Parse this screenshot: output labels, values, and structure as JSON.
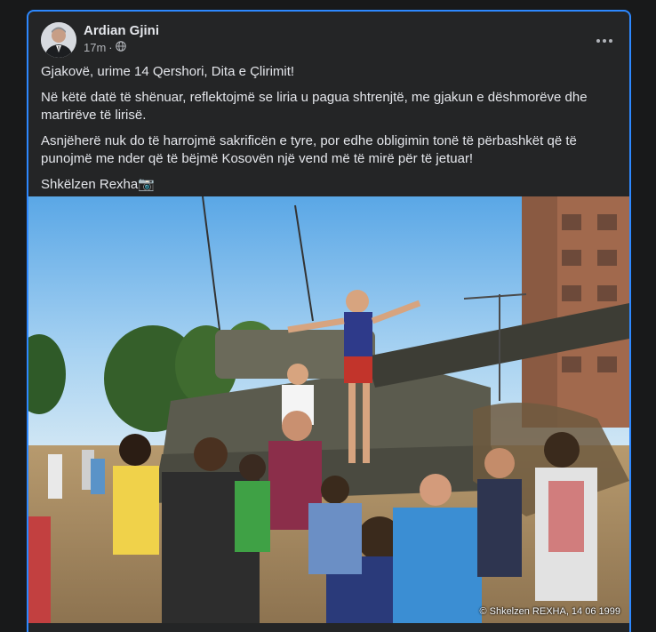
{
  "post": {
    "author_name": "Ardian Gjini",
    "timestamp": "17m",
    "separator": "·",
    "privacy_icon": "globe-icon",
    "more_icon": "more-horizontal-icon",
    "paragraphs": [
      "Gjakovë, urime 14 Qershori, Dita e Çlirimit!",
      "Në këtë datë të shënuar, reflektojmë se liria u pagua shtrenjtë, me gjakun e dëshmorëve dhe martirëve të lirisë.",
      "Asnjëherë nuk do të harrojmë sakrificën e tyre, por edhe obligimin tonë të përbashkët që të punojmë me nder që të bëjmë Kosovën një vend më të mirë për të jetuar!",
      "Shkëlzen Rexha📷"
    ],
    "photo": {
      "watermark": "© Shkelzen REXHA, 14 06 1999"
    }
  },
  "colors": {
    "feed_background": "#18191a",
    "card_background": "#242526",
    "focus_border": "#2d88ff",
    "primary_text": "#e4e6eb",
    "secondary_text": "#b0b3b8"
  }
}
